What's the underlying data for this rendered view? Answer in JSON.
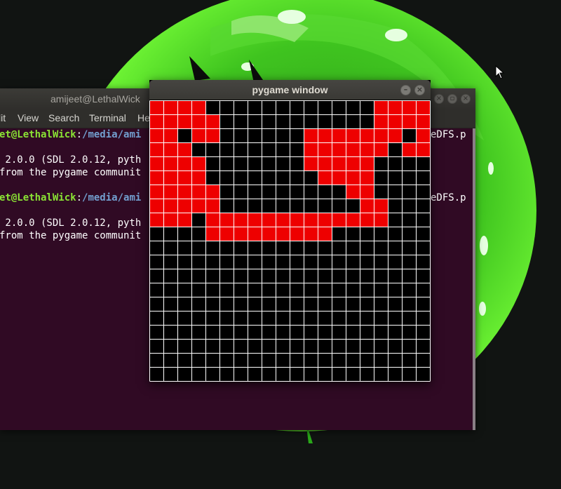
{
  "terminal": {
    "title": "amijeet@LethalWick",
    "menu": [
      "lit",
      "View",
      "Search",
      "Terminal",
      "He"
    ],
    "lines": [
      {
        "user": "et@LethalWick",
        "sep": ":",
        "path": "/media/ami",
        "tail": "eDFS.p"
      },
      {
        "text": " 2.0.0 (SDL 2.0.12, pyth"
      },
      {
        "text": "from the pygame communit"
      },
      {
        "user": "et@LethalWick",
        "sep": ":",
        "path": "/media/ami",
        "tail": "eDFS.p"
      },
      {
        "text": " 2.0.0 (SDL 2.0.12, pyth"
      },
      {
        "text": "from the pygame communit"
      }
    ]
  },
  "pygame_window": {
    "title": "pygame window",
    "grid": {
      "cols": 20,
      "rows": 20,
      "background": "#000000",
      "line_color": "#ffffff",
      "path_color": "#ee0000",
      "visited_cells": [
        [
          0,
          0
        ],
        [
          1,
          0
        ],
        [
          2,
          0
        ],
        [
          3,
          0
        ],
        [
          16,
          0
        ],
        [
          17,
          0
        ],
        [
          18,
          0
        ],
        [
          19,
          0
        ],
        [
          0,
          1
        ],
        [
          1,
          1
        ],
        [
          2,
          1
        ],
        [
          3,
          1
        ],
        [
          4,
          1
        ],
        [
          16,
          1
        ],
        [
          17,
          1
        ],
        [
          18,
          1
        ],
        [
          19,
          1
        ],
        [
          0,
          2
        ],
        [
          1,
          2
        ],
        [
          3,
          2
        ],
        [
          4,
          2
        ],
        [
          11,
          2
        ],
        [
          12,
          2
        ],
        [
          13,
          2
        ],
        [
          14,
          2
        ],
        [
          15,
          2
        ],
        [
          16,
          2
        ],
        [
          17,
          2
        ],
        [
          19,
          2
        ],
        [
          0,
          3
        ],
        [
          1,
          3
        ],
        [
          2,
          3
        ],
        [
          11,
          3
        ],
        [
          12,
          3
        ],
        [
          13,
          3
        ],
        [
          14,
          3
        ],
        [
          15,
          3
        ],
        [
          16,
          3
        ],
        [
          18,
          3
        ],
        [
          19,
          3
        ],
        [
          0,
          4
        ],
        [
          1,
          4
        ],
        [
          2,
          4
        ],
        [
          3,
          4
        ],
        [
          11,
          4
        ],
        [
          12,
          4
        ],
        [
          13,
          4
        ],
        [
          14,
          4
        ],
        [
          15,
          4
        ],
        [
          0,
          5
        ],
        [
          1,
          5
        ],
        [
          2,
          5
        ],
        [
          3,
          5
        ],
        [
          12,
          5
        ],
        [
          13,
          5
        ],
        [
          14,
          5
        ],
        [
          15,
          5
        ],
        [
          0,
          6
        ],
        [
          1,
          6
        ],
        [
          2,
          6
        ],
        [
          3,
          6
        ],
        [
          4,
          6
        ],
        [
          14,
          6
        ],
        [
          15,
          6
        ],
        [
          0,
          7
        ],
        [
          1,
          7
        ],
        [
          2,
          7
        ],
        [
          3,
          7
        ],
        [
          4,
          7
        ],
        [
          15,
          7
        ],
        [
          16,
          7
        ],
        [
          0,
          8
        ],
        [
          1,
          8
        ],
        [
          2,
          8
        ],
        [
          4,
          8
        ],
        [
          5,
          8
        ],
        [
          6,
          8
        ],
        [
          7,
          8
        ],
        [
          8,
          8
        ],
        [
          9,
          8
        ],
        [
          10,
          8
        ],
        [
          11,
          8
        ],
        [
          12,
          8
        ],
        [
          13,
          8
        ],
        [
          14,
          8
        ],
        [
          15,
          8
        ],
        [
          16,
          8
        ],
        [
          4,
          9
        ],
        [
          5,
          9
        ],
        [
          6,
          9
        ],
        [
          7,
          9
        ],
        [
          8,
          9
        ],
        [
          9,
          9
        ],
        [
          10,
          9
        ],
        [
          11,
          9
        ],
        [
          12,
          9
        ]
      ]
    }
  }
}
